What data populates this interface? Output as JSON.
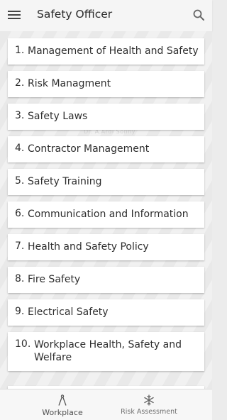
{
  "appbar": {
    "title": "Safety Officer",
    "menu_icon": "hamburger-menu-icon",
    "search_icon": "search-icon"
  },
  "content": {
    "watermark": "Dr. A.Ardi  Sonny",
    "items": [
      {
        "number": "1.",
        "label": "Management of Health and Safety"
      },
      {
        "number": "2.",
        "label": "Risk Managment"
      },
      {
        "number": "3.",
        "label": "Safety Laws"
      },
      {
        "number": "4.",
        "label": "Contractor Management"
      },
      {
        "number": "5.",
        "label": "Safety Training"
      },
      {
        "number": "6.",
        "label": "Communication and Information"
      },
      {
        "number": "7.",
        "label": "Health and Safety Policy"
      },
      {
        "number": "8.",
        "label": "Fire Safety"
      },
      {
        "number": "9.",
        "label": "Electrical Safety"
      },
      {
        "number": "10.",
        "label": "Workplace Health, Safety and Welfare"
      }
    ]
  },
  "bottom_nav": {
    "items": [
      {
        "label": "Workplace",
        "icon": "compass-icon"
      },
      {
        "label": "Risk Assessment",
        "icon": "snowflake-icon"
      }
    ]
  },
  "colors": {
    "appbar_bg": "#f5f5f5",
    "card_bg": "#ffffff",
    "text": "#2e2e2e"
  }
}
